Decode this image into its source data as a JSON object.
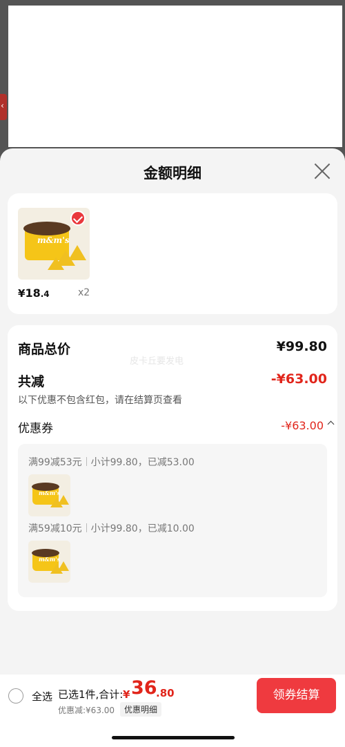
{
  "sheet": {
    "title": "金额明细"
  },
  "product": {
    "currency": "¥",
    "price_int": "18",
    "price_dec": ".4",
    "quantity": "x2",
    "selected": true,
    "brand_text": "m&m's"
  },
  "summary": {
    "total_label": "商品总价",
    "total_value": "¥99.80",
    "reduction_label": "共减",
    "reduction_value": "-¥63.00",
    "reduction_note": "以下优惠不包含红包，请在结算页查看",
    "coupon_label": "优惠券",
    "coupon_value": "-¥63.00"
  },
  "coupons": [
    {
      "rule": "满99减53元",
      "detail": "小计99.80，已减53.00"
    },
    {
      "rule": "满59减10元",
      "detail": "小计99.80，已减10.00"
    }
  ],
  "watermark": "皮卡丘要发电",
  "bottom_bar": {
    "select_all_label": "全选",
    "selection_summary": "已选1件,合计:",
    "total_currency": "¥",
    "total_int": "36",
    "total_dec": ".80",
    "discount_text": "优惠减:¥63.00",
    "detail_button": "优惠明细",
    "checkout_button": "领券结算"
  },
  "colors": {
    "accent_red": "#e1251b",
    "button_red": "#ef3a3f",
    "product_yellow": "#f5c518"
  }
}
